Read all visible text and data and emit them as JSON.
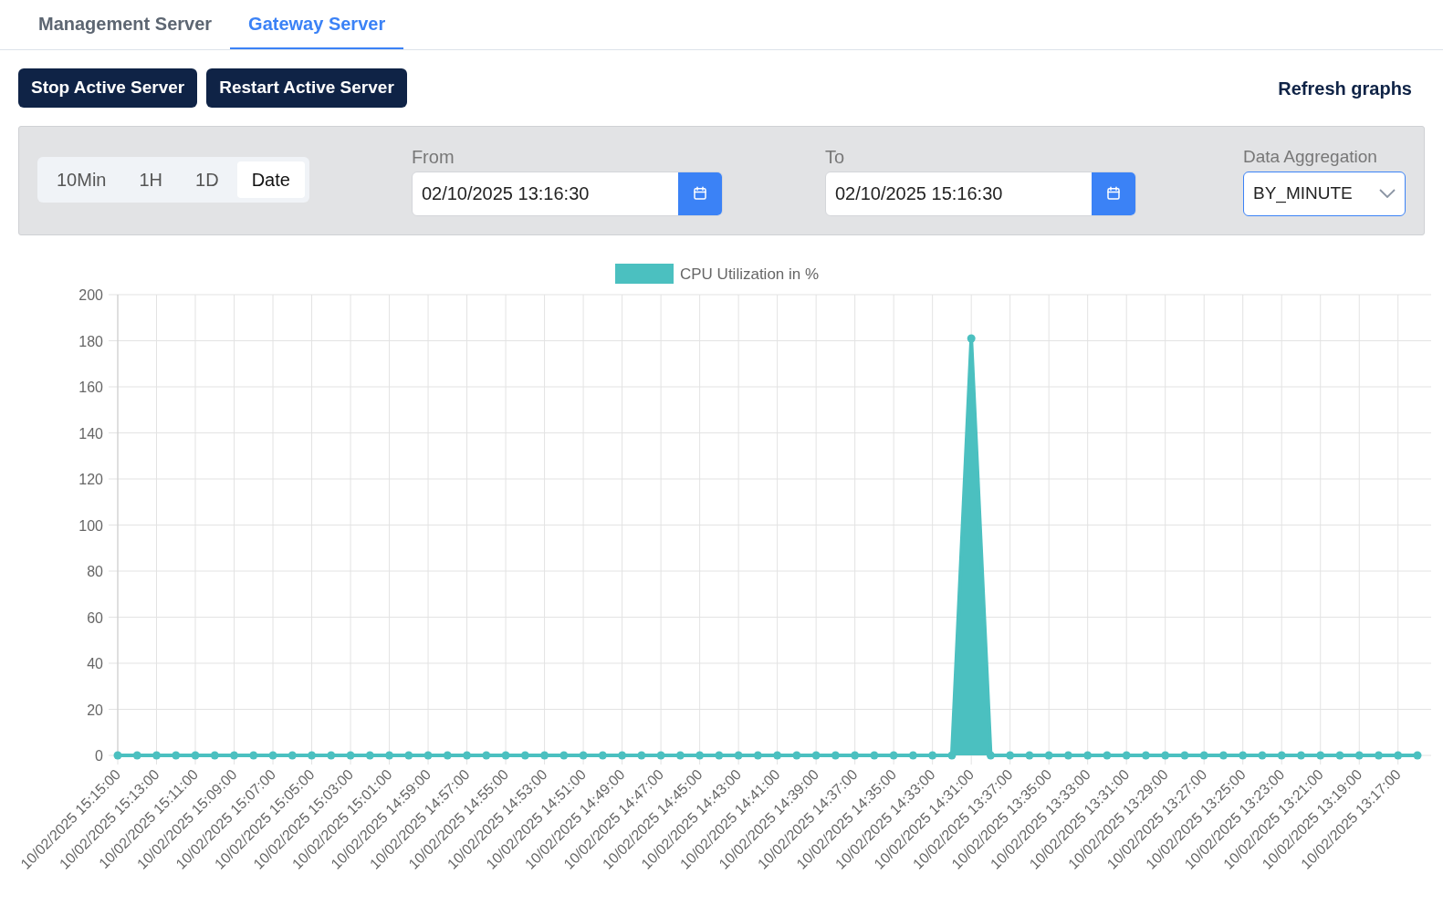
{
  "tabs": [
    {
      "label": "Management Server",
      "selected": false
    },
    {
      "label": "Gateway Server",
      "selected": true
    }
  ],
  "actions": [
    "Stop Active Server",
    "Restart Active Server"
  ],
  "refresh": "Refresh graphs",
  "filters": {
    "ranges": [
      {
        "label": "10Min",
        "selected": false
      },
      {
        "label": "1H",
        "selected": false
      },
      {
        "label": "1D",
        "selected": false
      },
      {
        "label": "Date",
        "selected": true
      }
    ],
    "from": {
      "label": "From",
      "value": "02/10/2025 13:16:30"
    },
    "to": {
      "label": "To",
      "value": "02/10/2025 15:16:30"
    },
    "aggregation": {
      "label": "Data Aggregation",
      "value": "BY_MINUTE"
    }
  },
  "chart_data": {
    "type": "area",
    "categories": [
      "10/02/2025 15:15:00",
      null,
      "10/02/2025 15:13:00",
      null,
      "10/02/2025 15:11:00",
      null,
      "10/02/2025 15:09:00",
      null,
      "10/02/2025 15:07:00",
      null,
      "10/02/2025 15:05:00",
      null,
      "10/02/2025 15:03:00",
      null,
      "10/02/2025 15:01:00",
      null,
      "10/02/2025 14:59:00",
      null,
      "10/02/2025 14:57:00",
      null,
      "10/02/2025 14:55:00",
      null,
      "10/02/2025 14:53:00",
      null,
      "10/02/2025 14:51:00",
      null,
      "10/02/2025 14:49:00",
      null,
      "10/02/2025 14:47:00",
      null,
      "10/02/2025 14:45:00",
      null,
      "10/02/2025 14:43:00",
      null,
      "10/02/2025 14:41:00",
      null,
      "10/02/2025 14:39:00",
      null,
      "10/02/2025 14:37:00",
      null,
      "10/02/2025 14:35:00",
      null,
      "10/02/2025 14:33:00",
      null,
      "10/02/2025 14:31:00",
      null,
      "10/02/2025 13:37:00",
      null,
      "10/02/2025 13:35:00",
      null,
      "10/02/2025 13:33:00",
      null,
      "10/02/2025 13:31:00",
      null,
      "10/02/2025 13:29:00",
      null,
      "10/02/2025 13:27:00",
      null,
      "10/02/2025 13:25:00",
      null,
      "10/02/2025 13:23:00",
      null,
      "10/02/2025 13:21:00",
      null,
      "10/02/2025 13:19:00",
      null,
      "10/02/2025 13:17:00",
      null
    ],
    "series": [
      {
        "name": "CPU Utilization in %",
        "color": "#4bc0c0",
        "values": [
          0,
          0,
          0,
          0,
          0,
          0,
          0,
          0,
          0,
          0,
          0,
          0,
          0,
          0,
          0,
          0,
          0,
          0,
          0,
          0,
          0,
          0,
          0,
          0,
          0,
          0,
          0,
          0,
          0,
          0,
          0,
          0,
          0,
          0,
          0,
          0,
          0,
          0,
          0,
          0,
          0,
          0,
          0,
          0,
          181,
          0,
          0,
          0,
          0,
          0,
          0,
          0,
          0,
          0,
          0,
          0,
          0,
          0,
          0,
          0,
          0,
          0,
          0,
          0,
          0,
          0,
          0,
          0
        ]
      }
    ],
    "grid": true,
    "ylim": [
      0,
      200
    ],
    "yticks": [
      0,
      20,
      40,
      60,
      80,
      100,
      120,
      140,
      160,
      180,
      200
    ]
  }
}
